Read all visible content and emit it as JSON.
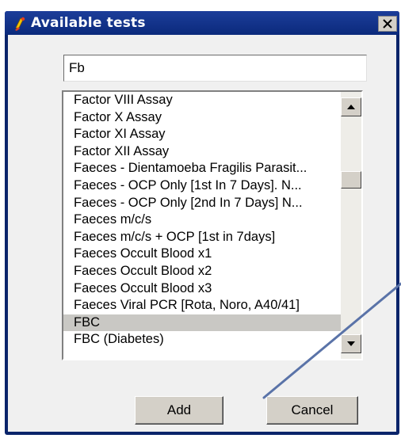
{
  "window": {
    "title": "Available tests"
  },
  "icons": {
    "app": "pill-person-icon",
    "close": "close-icon",
    "scroll_up": "scroll-up-arrow-icon",
    "scroll_down": "scroll-down-arrow-icon"
  },
  "search": {
    "value": "Fb"
  },
  "tests": [
    "Factor VIII Assay",
    "Factor X Assay",
    "Factor XI Assay",
    "Factor XII Assay",
    "Faeces - Dientamoeba Fragilis Parasit...",
    "Faeces - OCP Only [1st In 7 Days]. N...",
    "Faeces - OCP Only [2nd In 7 Days] N...",
    "Faeces m/c/s",
    "Faeces m/c/s + OCP [1st in 7days]",
    "Faeces Occult Blood x1",
    "Faeces Occult Blood x2",
    "Faeces Occult Blood x3",
    "Faeces Viral PCR [Rota, Noro, A40/41]",
    "FBC",
    "FBC (Diabetes)"
  ],
  "selected_test": "FBC",
  "buttons": {
    "add": "Add",
    "cancel": "Cancel"
  },
  "colors": {
    "titlebar": "#0a246a",
    "annotation_line": "#5a73a8",
    "selected_row": "#c9c8c4"
  }
}
